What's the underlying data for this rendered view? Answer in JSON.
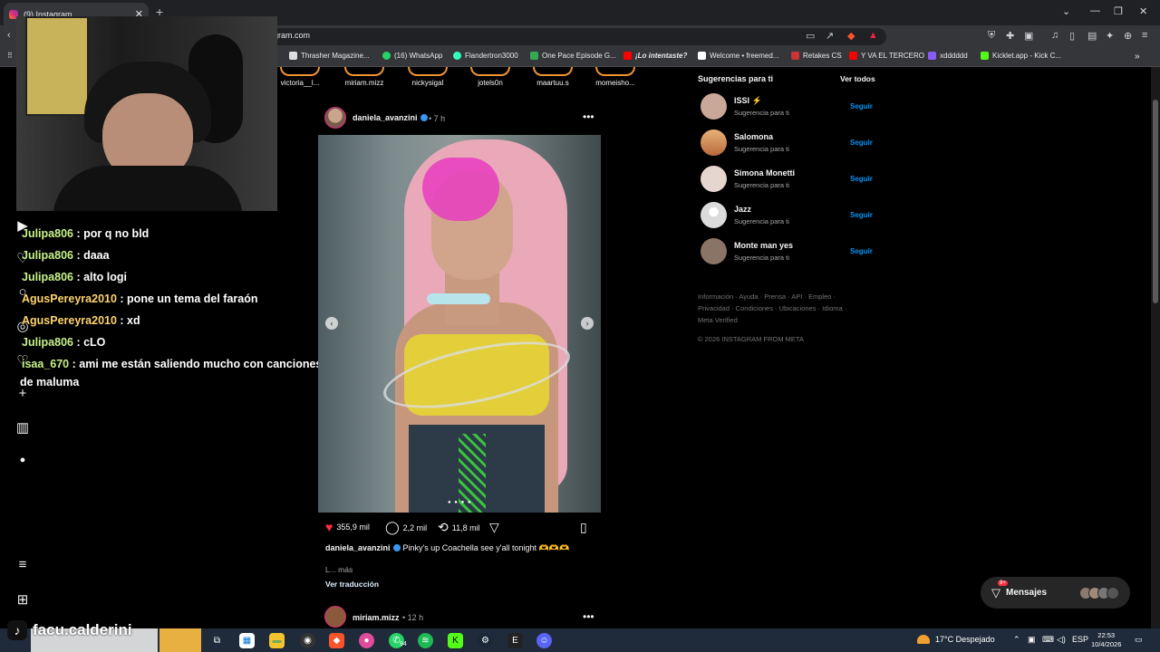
{
  "browser": {
    "tab_title": "(9) Instagram",
    "url": "gram.com",
    "bookmarks": [
      "Thrasher Magazine...",
      "(16) WhatsApp",
      "Flandertron3000",
      "One Pace Episode G...",
      "¡Lo intentaste?",
      "Welcome • freemed...",
      "Retakes CS",
      "Y VA EL TERCERO",
      "xdddddd",
      "Kicklet.app - Kick C..."
    ]
  },
  "chat": [
    {
      "user": "Julipa806",
      "text": " : por q no bld"
    },
    {
      "user": "Julipa806",
      "text": " : daaa"
    },
    {
      "user": "Julipa806",
      "text": " : alto logi"
    },
    {
      "user": "AgusPereyra2010",
      "text": " : pone un tema del faraón"
    },
    {
      "user": "AgusPereyra2010",
      "text": " : xd"
    },
    {
      "user": "Julipa806",
      "text": " : cLO"
    },
    {
      "user": "isaa_670",
      "text": " : ami me están saliendo mucho con canciones"
    },
    {
      "user": "",
      "text": "de maluma"
    }
  ],
  "stories": [
    "victoria__l...",
    "miriam.mizz",
    "nickysigal",
    "jotels0n",
    "maartuu.s",
    "momeisho..."
  ],
  "post": {
    "username": "daniela_avanzini",
    "time": "7 h",
    "likes": "355,9 mil",
    "comments": "2,2 mil",
    "reposts": "11,8 mil",
    "caption_user": "daniela_avanzini",
    "caption_text": "Pinky's up Coachella see y'all tonight 🫶🫶🫶",
    "more": "L... más",
    "translate": "Ver traducción"
  },
  "next_post": {
    "username": "miriam.mizz",
    "time": "12 h"
  },
  "suggestions": {
    "title": "Sugerencias para ti",
    "see_all": "Ver todos",
    "items": [
      {
        "name": "ISSI ⚡",
        "sub": "Sugerencia para ti",
        "follow": "Seguir",
        "color": "#c9a89a"
      },
      {
        "name": "Salomona",
        "sub": "Sugerencia para ti",
        "follow": "Seguir",
        "color": "#d99a5a"
      },
      {
        "name": "Simona Monetti",
        "sub": "Sugerencia para ti",
        "follow": "Seguir",
        "color": "#e6d6d0"
      },
      {
        "name": "Jazz",
        "sub": "Sugerencia para ti",
        "follow": "Seguir",
        "color": "#dbdbdb"
      },
      {
        "name": "Monte man yes",
        "sub": "Sugerencia para ti",
        "follow": "Seguir",
        "color": "#8a7466"
      }
    ]
  },
  "footer": {
    "links": "Información · Ayuda · Prensa · API · Empleo · Privacidad · Condiciones · Ubicaciones · Idioma · Meta Verified",
    "copyright": "© 2026 INSTAGRAM FROM META"
  },
  "messages": {
    "label": "Mensajes",
    "badge": "9+"
  },
  "overlay": {
    "tiktok_user": "facu.calderini"
  },
  "taskbar": {
    "weather": "17°C  Despejado",
    "lang": "ESP",
    "time": "22:53",
    "date": "10/4/2026",
    "badge_94": "94"
  }
}
